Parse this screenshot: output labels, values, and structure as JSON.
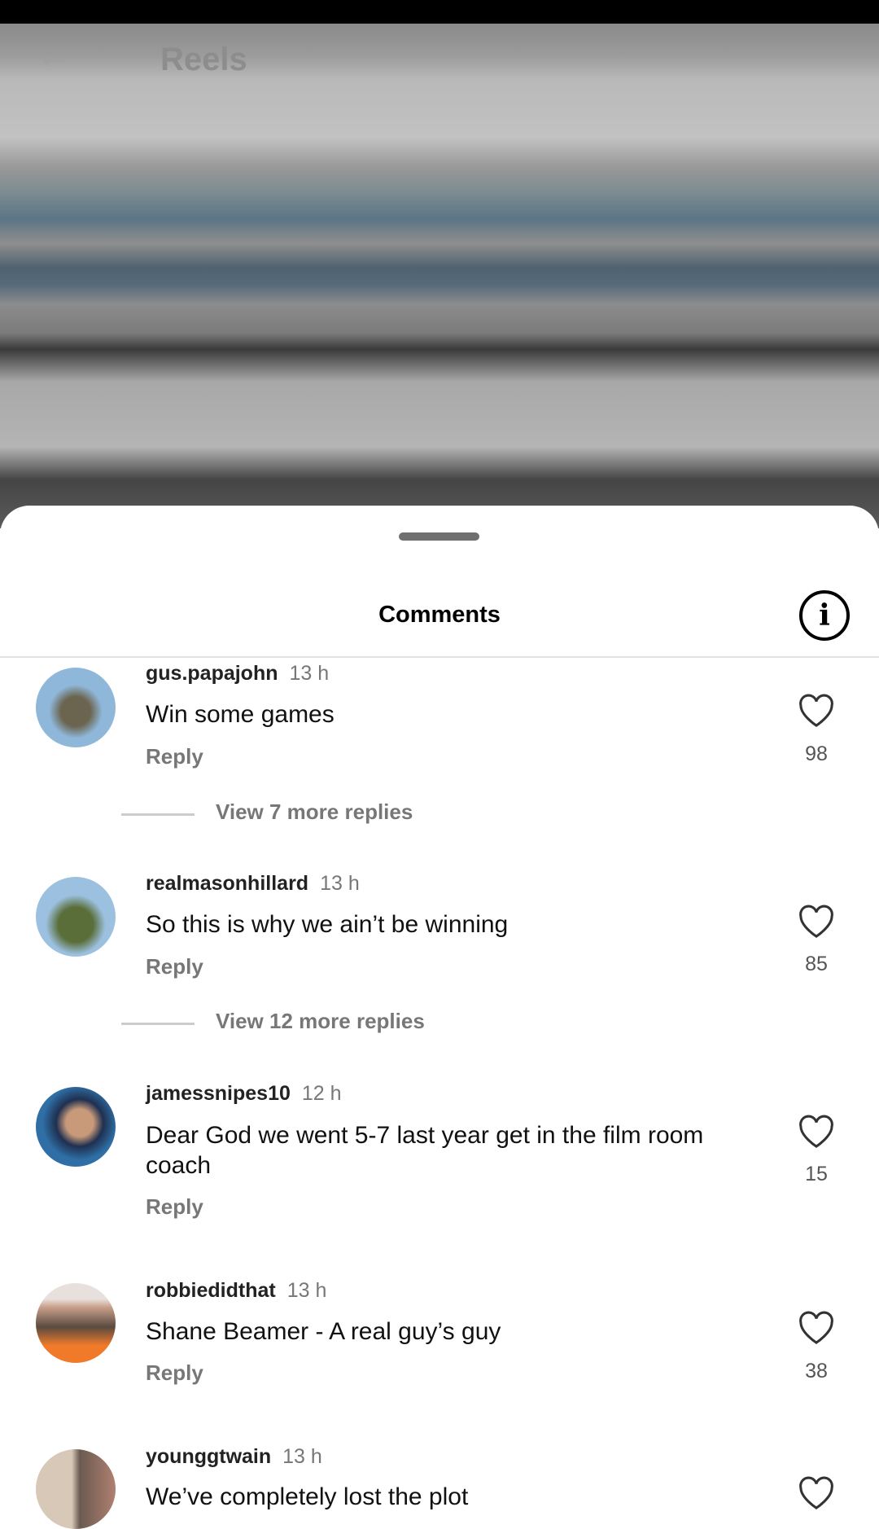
{
  "header": {
    "title": "Reels",
    "back_icon": "arrow-left-icon"
  },
  "sheet": {
    "title": "Comments",
    "info_icon": "info-icon"
  },
  "comments": [
    {
      "username": "gus.papajohn",
      "time": "13 h",
      "text": "Win some games",
      "reply": "Reply",
      "likes": "98",
      "view_replies": "View 7 more replies",
      "avatar_colors": [
        "#8fb7d9",
        "#6b6550"
      ]
    },
    {
      "username": "realmasonhillard",
      "time": "13 h",
      "text": "So this is why we ain’t be winning",
      "reply": "Reply",
      "likes": "85",
      "view_replies": "View 12 more replies",
      "avatar_colors": [
        "#9cc1e0",
        "#5a6e3a"
      ]
    },
    {
      "username": "jamessnipes10",
      "time": "12 h",
      "text": "Dear God we went 5-7 last year get in the film room coach",
      "reply": "Reply",
      "likes": "15",
      "avatar_colors": [
        "#2f6fa6",
        "#c99a7a"
      ]
    },
    {
      "username": "robbiedidthat",
      "time": "13 h",
      "text": "Shane Beamer - A real guy’s guy",
      "reply": "Reply",
      "likes": "38",
      "avatar_colors": [
        "#e8e0dc",
        "#f07a2a"
      ]
    },
    {
      "username": "younggtwain",
      "time": "13 h",
      "text": "We’ve completely lost the plot",
      "avatar_colors": [
        "#6a5a50",
        "#d8c8b8"
      ]
    }
  ]
}
